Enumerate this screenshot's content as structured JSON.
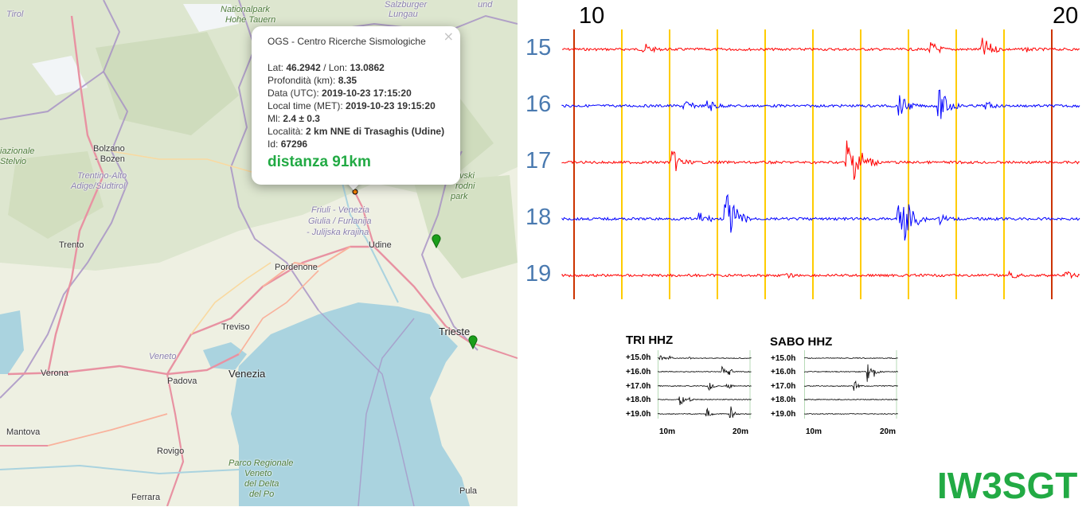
{
  "popup": {
    "title": "OGS - Centro Ricerche Sismologiche",
    "close_symbol": "×",
    "lat_label": "Lat: ",
    "lat_value": "46.2942",
    "lon_label": " / Lon: ",
    "lon_value": "13.0862",
    "depth_label": "Profondità (km): ",
    "depth_value": "8.35",
    "date_utc_label": "Data (UTC): ",
    "date_utc_value": "2019-10-23 17:15:20",
    "local_time_label": "Local time (MET): ",
    "local_time_value": "2019-10-23 19:15:20",
    "ml_label": "Ml: ",
    "ml_value": "2.4 ± 0.3",
    "location_label": "Località: ",
    "location_value": "2 km NNE di Trasaghis (Udine)",
    "id_label": "Id: ",
    "id_value": "67296",
    "distance": "distanza 91km"
  },
  "map_labels": {
    "tirol": "Tirol",
    "nationalpark": "Nationalpark",
    "hohe_tauern": "Hohe Tauern",
    "salzburger": "Salzburger",
    "lungau": "Lungau",
    "und": "und",
    "iazionale": "iazionale",
    "stelvio": "Stelvio",
    "bolzano": "Bolzano",
    "bozen": "- Bozen",
    "trentino": "Trentino-Alto",
    "adige": "Adige/Südtirol",
    "vski": "vski",
    "rodni": "rodni",
    "park": "park",
    "friuli1": "Friuli - Venezia",
    "friuli2": "Giulia / Furlanija",
    "friuli3": "- Julijska krajina",
    "udine": "Udine",
    "trento": "Trento",
    "pordenone": "Pordenone",
    "treviso": "Treviso",
    "trieste": "Trieste",
    "veneto": "Veneto",
    "venezia": "Venezia",
    "verona": "Verona",
    "padova": "Padova",
    "mantova": "Mantova",
    "rovigo": "Rovigo",
    "parco1": "Parco Regionale",
    "parco2": "Veneto",
    "parco3": "del Delta",
    "parco4": "del Po",
    "pula": "Pula",
    "ferrara": "Ferrara"
  },
  "helicorder": {
    "minute_labels": [
      "10",
      "20"
    ],
    "hour_labels": [
      "15",
      "16",
      "17",
      "18",
      "19"
    ],
    "trace_colors": [
      "#ff0000",
      "#0000ff",
      "#ff0000",
      "#0000ff",
      "#ff0000"
    ],
    "grid_color": "#ffcc00",
    "event_line_color": "#cc3300"
  },
  "mini_plots": [
    {
      "title": "TRI HHZ",
      "rows": [
        "+15.0h",
        "+16.0h",
        "+17.0h",
        "+18.0h",
        "+19.0h"
      ],
      "ticks": [
        "10m",
        "20m"
      ]
    },
    {
      "title": "SABO HHZ",
      "rows": [
        "+15.0h",
        "+16.0h",
        "+17.0h",
        "+18.0h",
        "+19.0h"
      ],
      "ticks": [
        "10m",
        "20m"
      ]
    }
  ],
  "callsign": "IW3SGT",
  "colors": {
    "accent_green": "#22aa44",
    "hour_label_blue": "#4a7ab0",
    "sea": "#aad3df",
    "land": "#eef0e2"
  },
  "icons": {
    "close": "close-icon",
    "station_marker": "map-marker-icon"
  }
}
